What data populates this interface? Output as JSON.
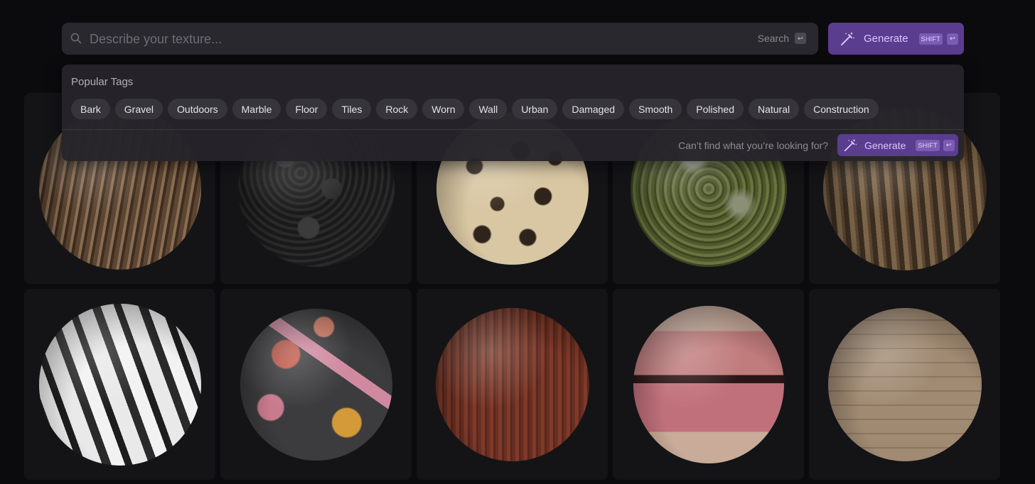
{
  "search": {
    "placeholder": "Describe your texture...",
    "hint_label": "Search",
    "enter_key": "↩"
  },
  "generate_button": {
    "label": "Generate",
    "shift_key": "SHIFT",
    "enter_key": "↩"
  },
  "popular_tags": {
    "title": "Popular Tags",
    "tags": [
      "Bark",
      "Gravel",
      "Outdoors",
      "Marble",
      "Floor",
      "Tiles",
      "Rock",
      "Worn",
      "Wall",
      "Urban",
      "Damaged",
      "Smooth",
      "Polished",
      "Natural",
      "Construction"
    ]
  },
  "footer": {
    "cant_find_text": "Can’t find what you’re looking for?",
    "generate_label": "Generate",
    "shift_key": "SHIFT",
    "enter_key": "↩"
  },
  "textures": [
    {
      "icon": "bark-sphere"
    },
    {
      "icon": "black-rock-sphere"
    },
    {
      "icon": "leopard-fur-sphere"
    },
    {
      "icon": "mossy-rock-sphere"
    },
    {
      "icon": "twisted-roots-sphere"
    },
    {
      "icon": "snow-rock-sphere"
    },
    {
      "icon": "terrazzo-sphere"
    },
    {
      "icon": "polished-wood-sphere"
    },
    {
      "icon": "lips-sphere"
    },
    {
      "icon": "stone-wall-sphere"
    }
  ],
  "colors": {
    "background": "#0b0b0d",
    "accent": "#5b3d8f",
    "accent_text": "#d9c7ff",
    "panel": "#26242a",
    "card": "#141417"
  }
}
